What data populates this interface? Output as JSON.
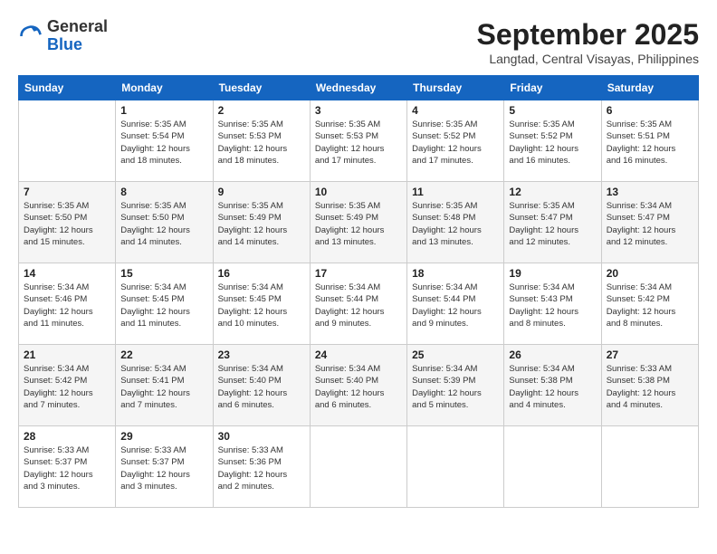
{
  "logo": {
    "general": "General",
    "blue": "Blue"
  },
  "header": {
    "month": "September 2025",
    "location": "Langtad, Central Visayas, Philippines"
  },
  "columns": [
    "Sunday",
    "Monday",
    "Tuesday",
    "Wednesday",
    "Thursday",
    "Friday",
    "Saturday"
  ],
  "weeks": [
    [
      {
        "day": "",
        "info": ""
      },
      {
        "day": "1",
        "info": "Sunrise: 5:35 AM\nSunset: 5:54 PM\nDaylight: 12 hours\nand 18 minutes."
      },
      {
        "day": "2",
        "info": "Sunrise: 5:35 AM\nSunset: 5:53 PM\nDaylight: 12 hours\nand 18 minutes."
      },
      {
        "day": "3",
        "info": "Sunrise: 5:35 AM\nSunset: 5:53 PM\nDaylight: 12 hours\nand 17 minutes."
      },
      {
        "day": "4",
        "info": "Sunrise: 5:35 AM\nSunset: 5:52 PM\nDaylight: 12 hours\nand 17 minutes."
      },
      {
        "day": "5",
        "info": "Sunrise: 5:35 AM\nSunset: 5:52 PM\nDaylight: 12 hours\nand 16 minutes."
      },
      {
        "day": "6",
        "info": "Sunrise: 5:35 AM\nSunset: 5:51 PM\nDaylight: 12 hours\nand 16 minutes."
      }
    ],
    [
      {
        "day": "7",
        "info": "Sunrise: 5:35 AM\nSunset: 5:50 PM\nDaylight: 12 hours\nand 15 minutes."
      },
      {
        "day": "8",
        "info": "Sunrise: 5:35 AM\nSunset: 5:50 PM\nDaylight: 12 hours\nand 14 minutes."
      },
      {
        "day": "9",
        "info": "Sunrise: 5:35 AM\nSunset: 5:49 PM\nDaylight: 12 hours\nand 14 minutes."
      },
      {
        "day": "10",
        "info": "Sunrise: 5:35 AM\nSunset: 5:49 PM\nDaylight: 12 hours\nand 13 minutes."
      },
      {
        "day": "11",
        "info": "Sunrise: 5:35 AM\nSunset: 5:48 PM\nDaylight: 12 hours\nand 13 minutes."
      },
      {
        "day": "12",
        "info": "Sunrise: 5:35 AM\nSunset: 5:47 PM\nDaylight: 12 hours\nand 12 minutes."
      },
      {
        "day": "13",
        "info": "Sunrise: 5:34 AM\nSunset: 5:47 PM\nDaylight: 12 hours\nand 12 minutes."
      }
    ],
    [
      {
        "day": "14",
        "info": "Sunrise: 5:34 AM\nSunset: 5:46 PM\nDaylight: 12 hours\nand 11 minutes."
      },
      {
        "day": "15",
        "info": "Sunrise: 5:34 AM\nSunset: 5:45 PM\nDaylight: 12 hours\nand 11 minutes."
      },
      {
        "day": "16",
        "info": "Sunrise: 5:34 AM\nSunset: 5:45 PM\nDaylight: 12 hours\nand 10 minutes."
      },
      {
        "day": "17",
        "info": "Sunrise: 5:34 AM\nSunset: 5:44 PM\nDaylight: 12 hours\nand 9 minutes."
      },
      {
        "day": "18",
        "info": "Sunrise: 5:34 AM\nSunset: 5:44 PM\nDaylight: 12 hours\nand 9 minutes."
      },
      {
        "day": "19",
        "info": "Sunrise: 5:34 AM\nSunset: 5:43 PM\nDaylight: 12 hours\nand 8 minutes."
      },
      {
        "day": "20",
        "info": "Sunrise: 5:34 AM\nSunset: 5:42 PM\nDaylight: 12 hours\nand 8 minutes."
      }
    ],
    [
      {
        "day": "21",
        "info": "Sunrise: 5:34 AM\nSunset: 5:42 PM\nDaylight: 12 hours\nand 7 minutes."
      },
      {
        "day": "22",
        "info": "Sunrise: 5:34 AM\nSunset: 5:41 PM\nDaylight: 12 hours\nand 7 minutes."
      },
      {
        "day": "23",
        "info": "Sunrise: 5:34 AM\nSunset: 5:40 PM\nDaylight: 12 hours\nand 6 minutes."
      },
      {
        "day": "24",
        "info": "Sunrise: 5:34 AM\nSunset: 5:40 PM\nDaylight: 12 hours\nand 6 minutes."
      },
      {
        "day": "25",
        "info": "Sunrise: 5:34 AM\nSunset: 5:39 PM\nDaylight: 12 hours\nand 5 minutes."
      },
      {
        "day": "26",
        "info": "Sunrise: 5:34 AM\nSunset: 5:38 PM\nDaylight: 12 hours\nand 4 minutes."
      },
      {
        "day": "27",
        "info": "Sunrise: 5:33 AM\nSunset: 5:38 PM\nDaylight: 12 hours\nand 4 minutes."
      }
    ],
    [
      {
        "day": "28",
        "info": "Sunrise: 5:33 AM\nSunset: 5:37 PM\nDaylight: 12 hours\nand 3 minutes."
      },
      {
        "day": "29",
        "info": "Sunrise: 5:33 AM\nSunset: 5:37 PM\nDaylight: 12 hours\nand 3 minutes."
      },
      {
        "day": "30",
        "info": "Sunrise: 5:33 AM\nSunset: 5:36 PM\nDaylight: 12 hours\nand 2 minutes."
      },
      {
        "day": "",
        "info": ""
      },
      {
        "day": "",
        "info": ""
      },
      {
        "day": "",
        "info": ""
      },
      {
        "day": "",
        "info": ""
      }
    ]
  ]
}
